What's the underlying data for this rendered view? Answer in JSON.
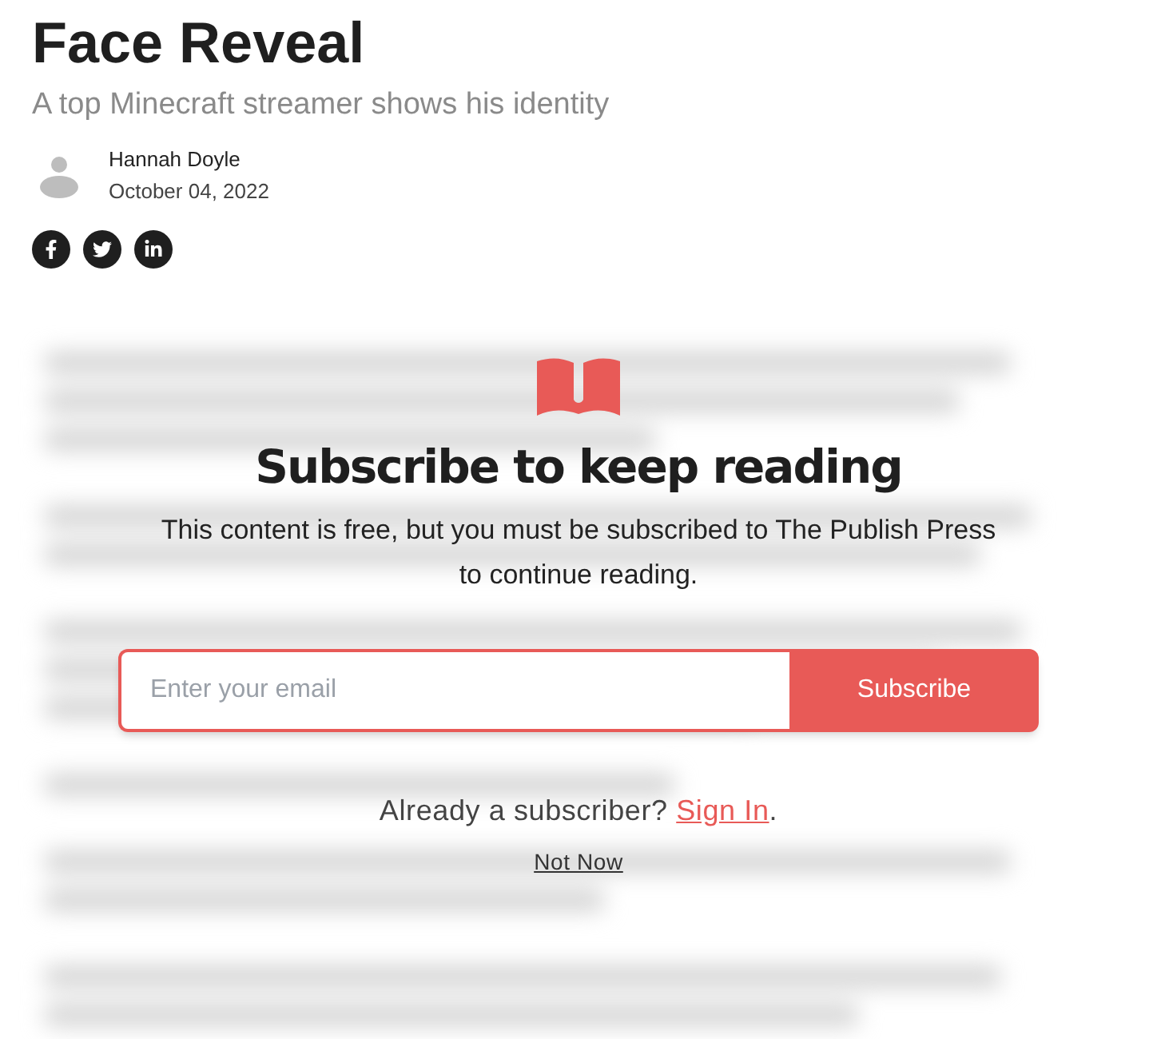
{
  "article": {
    "title": "Face Reveal",
    "subtitle": "A top Minecraft streamer shows his identity",
    "author": "Hannah Doyle",
    "date": "October 04, 2022",
    "share": [
      {
        "kind": "facebook"
      },
      {
        "kind": "twitter"
      },
      {
        "kind": "linkedin"
      }
    ]
  },
  "paywall": {
    "heading": "Subscribe to keep reading",
    "message": "This content is free, but you must be subscribed to The Publish Press to continue reading.",
    "email": {
      "placeholder": "Enter your email"
    },
    "button": "Subscribe",
    "signin_prompt": "Already a subscriber?",
    "signin_link": "Sign In",
    "signin_suffix": ".",
    "dismiss": "Not Now"
  }
}
